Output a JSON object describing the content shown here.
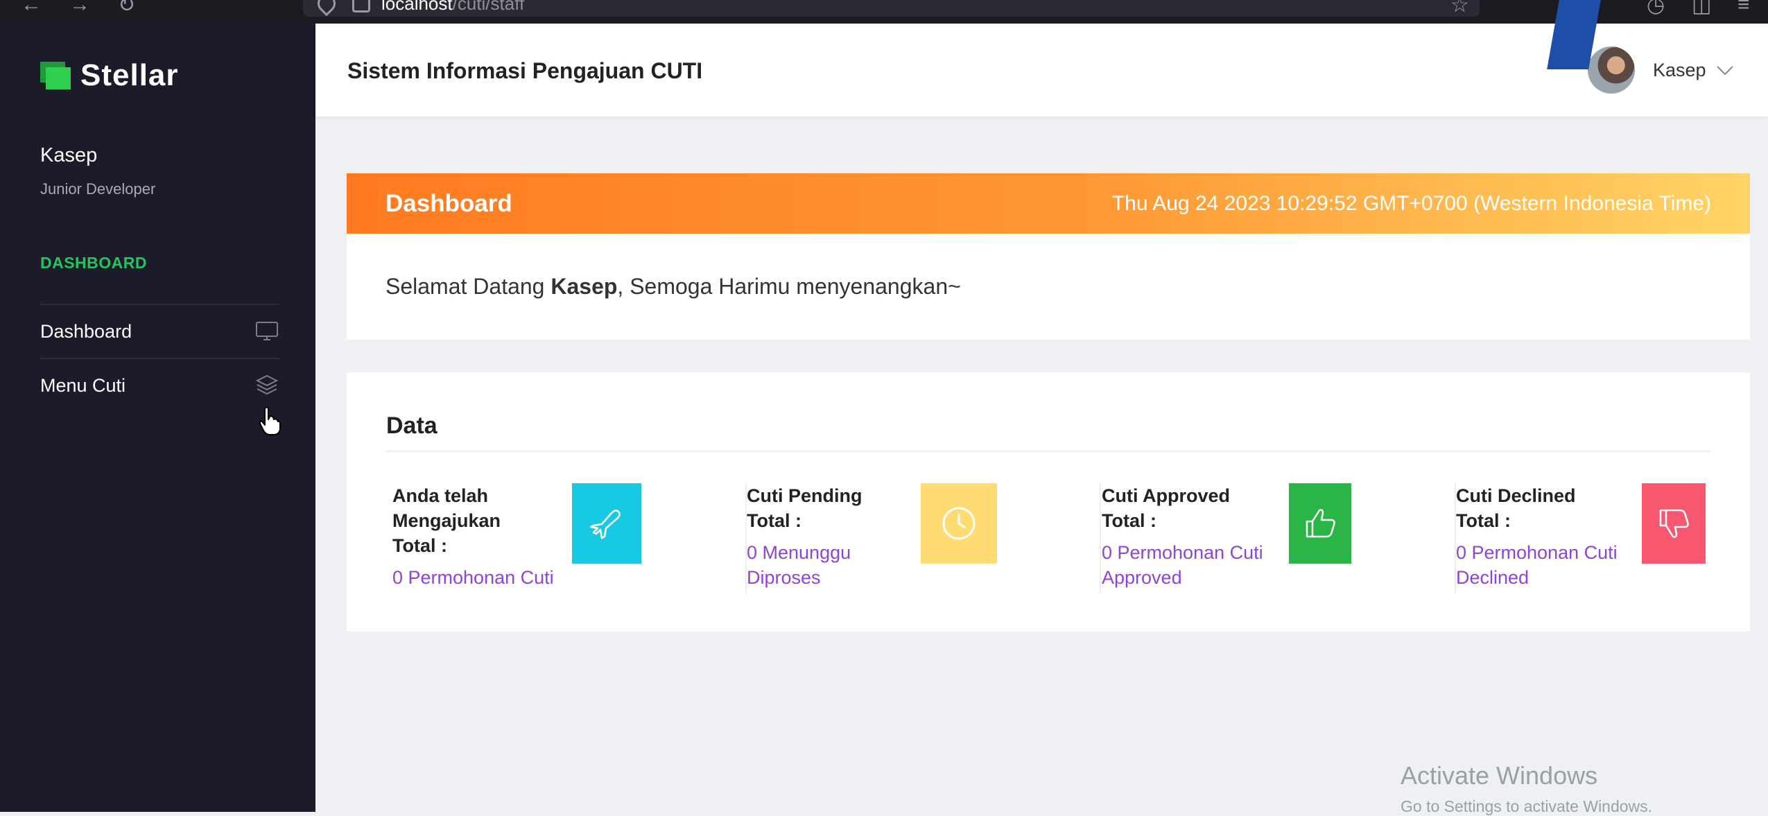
{
  "browser": {
    "url_host": "localhost",
    "url_path": "/cuti/staff"
  },
  "sidebar": {
    "brand": "Stellar",
    "user_name": "Kasep",
    "user_role": "Junior Developer",
    "section": "DASHBOARD",
    "items": [
      {
        "label": "Dashboard",
        "icon": "monitor-icon"
      },
      {
        "label": "Menu Cuti",
        "icon": "layers-icon"
      }
    ]
  },
  "header": {
    "title": "Sistem Informasi Pengajuan CUTI",
    "user": "Kasep"
  },
  "banner": {
    "title": "Dashboard",
    "datetime": "Thu Aug 24 2023 10:29:52 GMT+0700 (Western Indonesia Time)"
  },
  "welcome": {
    "prefix": "Selamat Datang ",
    "name": "Kasep",
    "suffix": ", Semoga Harimu menyenangkan~"
  },
  "data": {
    "heading": "Data",
    "stats": [
      {
        "label_lines": [
          "Anda telah",
          "Mengajukan",
          "Total :"
        ],
        "value_lines": [
          "0 Permohonan Cuti"
        ],
        "icon": "plane-icon",
        "color": "#17c9e3"
      },
      {
        "label_lines": [
          "Cuti Pending",
          "Total :"
        ],
        "value_lines": [
          "0 Menunggu",
          "Diproses"
        ],
        "icon": "clock-icon",
        "color": "#ffdc73"
      },
      {
        "label_lines": [
          "Cuti Approved",
          "Total :"
        ],
        "value_lines": [
          "0 Permohonan Cuti",
          "Approved"
        ],
        "icon": "thumbs-up-icon",
        "color": "#2ab546"
      },
      {
        "label_lines": [
          "Cuti Declined",
          "Total :"
        ],
        "value_lines": [
          "0 Permohonan Cuti",
          "Declined"
        ],
        "icon": "thumbs-down-icon",
        "color": "#f7586f"
      }
    ]
  },
  "watermark": {
    "line1": "Activate Windows",
    "line2": "Go to Settings to activate Windows."
  },
  "colors": {
    "sidebar_bg": "#1b1b2a",
    "accent_green": "#22c55e",
    "value_purple": "#8e44d6"
  }
}
